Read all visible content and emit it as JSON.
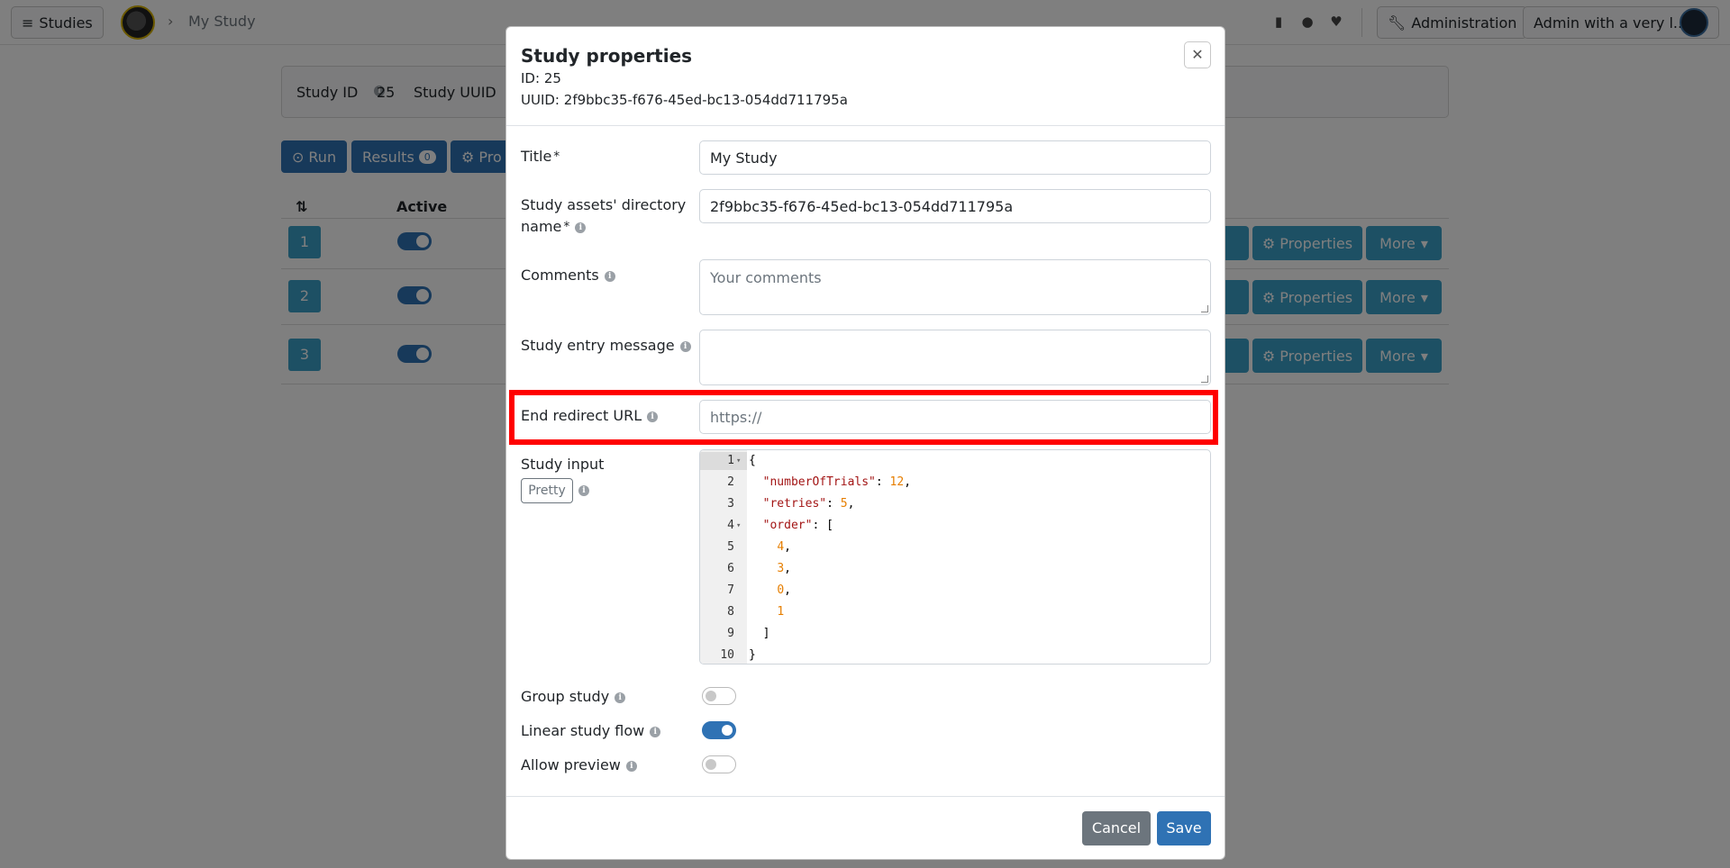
{
  "nav": {
    "studies_label": "Studies",
    "breadcrumb_study": "My Study",
    "admin_label": "Administration",
    "user_label": "Admin with a very l..."
  },
  "page": {
    "study_id_label": "Study ID",
    "study_id_value": "25",
    "study_uuid_label": "Study UUID",
    "run_label": "Run",
    "results_label": "Results",
    "results_count": "0",
    "properties_cut_label": "Pro",
    "active_col": "Active",
    "sort_col": "⇅",
    "rows": [
      {
        "num": "1",
        "properties": "Properties",
        "more": "More"
      },
      {
        "num": "2",
        "properties": "Properties",
        "more": "More"
      },
      {
        "num": "3",
        "properties": "Properties",
        "more": "More"
      }
    ]
  },
  "modal": {
    "title": "Study properties",
    "id_label": "ID:",
    "id_value": "25",
    "uuid_label": "UUID:",
    "uuid_value": "2f9bbc35-f676-45ed-bc13-054dd711795a",
    "fields": {
      "title_label": "Title",
      "title_value": "My Study",
      "dir_label_1": "Study assets' directory",
      "dir_label_2": "name",
      "dir_value": "2f9bbc35-f676-45ed-bc13-054dd711795a",
      "comments_label": "Comments",
      "comments_placeholder": "Your comments",
      "entry_label": "Study entry message",
      "redirect_label": "End redirect URL",
      "redirect_placeholder": "https://",
      "input_label": "Study input",
      "pretty_label": "Pretty"
    },
    "code": [
      {
        "ln": "1",
        "text": "{"
      },
      {
        "ln": "2",
        "key": "\"numberOfTrials\"",
        "val": "12",
        "tail": ","
      },
      {
        "ln": "3",
        "key": "\"retries\"",
        "val": "5",
        "tail": ","
      },
      {
        "ln": "4",
        "key": "\"order\"",
        "rest": ": ["
      },
      {
        "ln": "5",
        "val": "4",
        "tail": ","
      },
      {
        "ln": "6",
        "val": "3",
        "tail": ","
      },
      {
        "ln": "7",
        "val": "0",
        "tail": ","
      },
      {
        "ln": "8",
        "val": "1"
      },
      {
        "ln": "9",
        "text": "  ]"
      },
      {
        "ln": "10",
        "text": "}"
      }
    ],
    "toggles": {
      "group_label": "Group study",
      "group_on": false,
      "linear_label": "Linear study flow",
      "linear_on": true,
      "preview_label": "Allow preview",
      "preview_on": false
    },
    "cancel_label": "Cancel",
    "save_label": "Save"
  }
}
